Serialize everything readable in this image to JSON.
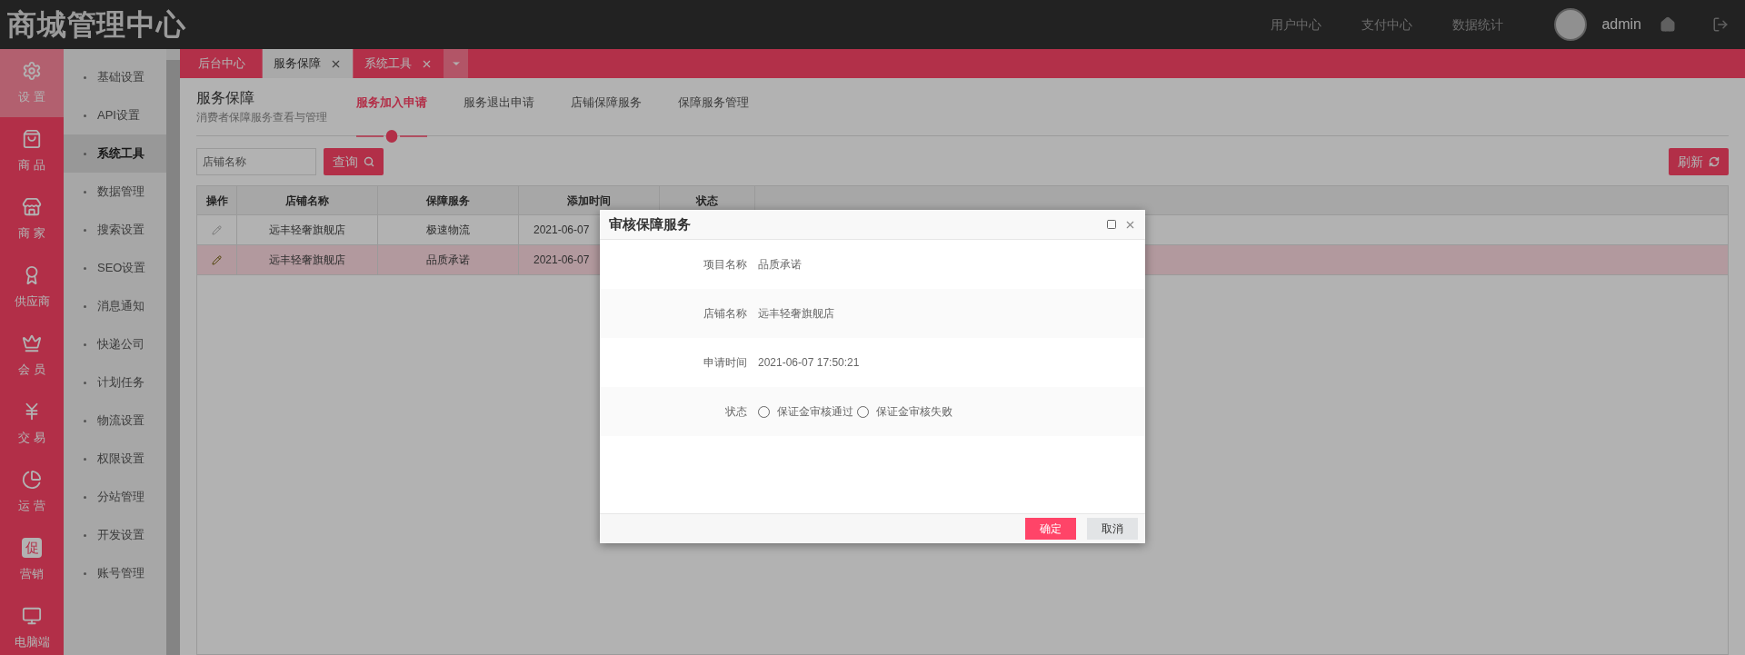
{
  "header": {
    "title": "商城管理中心",
    "nav": [
      "用户中心",
      "支付中心",
      "数据统计"
    ],
    "user": "admin"
  },
  "sidebar": {
    "items": [
      {
        "label": "设 置",
        "selected": true
      },
      {
        "label": "商 品",
        "selected": false
      },
      {
        "label": "商 家",
        "selected": false
      },
      {
        "label": "供应商",
        "selected": false
      },
      {
        "label": "会 员",
        "selected": false
      },
      {
        "label": "交 易",
        "selected": false
      },
      {
        "label": "运 营",
        "selected": false
      },
      {
        "label": "营销",
        "selected": false,
        "glyph": "促"
      },
      {
        "label": "电脑端",
        "selected": false
      }
    ]
  },
  "submenu": {
    "items": [
      {
        "label": "基础设置",
        "selected": false
      },
      {
        "label": "API设置",
        "selected": false
      },
      {
        "label": "系统工具",
        "selected": true
      },
      {
        "label": "数据管理",
        "selected": false
      },
      {
        "label": "搜索设置",
        "selected": false
      },
      {
        "label": "SEO设置",
        "selected": false
      },
      {
        "label": "消息通知",
        "selected": false
      },
      {
        "label": "快递公司",
        "selected": false
      },
      {
        "label": "计划任务",
        "selected": false
      },
      {
        "label": "物流设置",
        "selected": false
      },
      {
        "label": "权限设置",
        "selected": false
      },
      {
        "label": "分站管理",
        "selected": false
      },
      {
        "label": "开发设置",
        "selected": false
      },
      {
        "label": "账号管理",
        "selected": false
      }
    ]
  },
  "tabs": [
    {
      "label": "后台中心",
      "selected": false,
      "closable": false
    },
    {
      "label": "服务保障",
      "selected": true,
      "closable": true
    },
    {
      "label": "系统工具",
      "selected": false,
      "closable": true
    }
  ],
  "page": {
    "title": "服务保障",
    "subtitle": "消费者保障服务查看与管理",
    "subtabs": [
      {
        "label": "服务加入申请",
        "selected": true
      },
      {
        "label": "服务退出申请",
        "selected": false
      },
      {
        "label": "店铺保障服务",
        "selected": false
      },
      {
        "label": "保障服务管理",
        "selected": false
      }
    ],
    "search": {
      "placeholder": "店铺名称"
    },
    "query_button": "查询",
    "refresh_button": "刷新"
  },
  "table": {
    "columns": [
      "操作",
      "店铺名称",
      "保障服务",
      "添加时间",
      "状态"
    ],
    "rows": [
      {
        "selected": false,
        "store": "远丰轻奢旗舰店",
        "service": "极速物流",
        "time": "2021-06-07"
      },
      {
        "selected": true,
        "store": "远丰轻奢旗舰店",
        "service": "品质承诺",
        "time": "2021-06-07"
      }
    ]
  },
  "dialog": {
    "title": "审核保障服务",
    "fields": [
      {
        "label": "项目名称",
        "value": "品质承诺"
      },
      {
        "label": "店铺名称",
        "value": "远丰轻奢旗舰店"
      },
      {
        "label": "申请时间",
        "value": "2021-06-07 17:50:21"
      }
    ],
    "status": {
      "label": "状态",
      "options": [
        {
          "label": "保证金审核通过",
          "selected": false
        },
        {
          "label": "保证金审核失败",
          "selected": false
        }
      ]
    },
    "confirm": "确定",
    "cancel": "取消"
  }
}
